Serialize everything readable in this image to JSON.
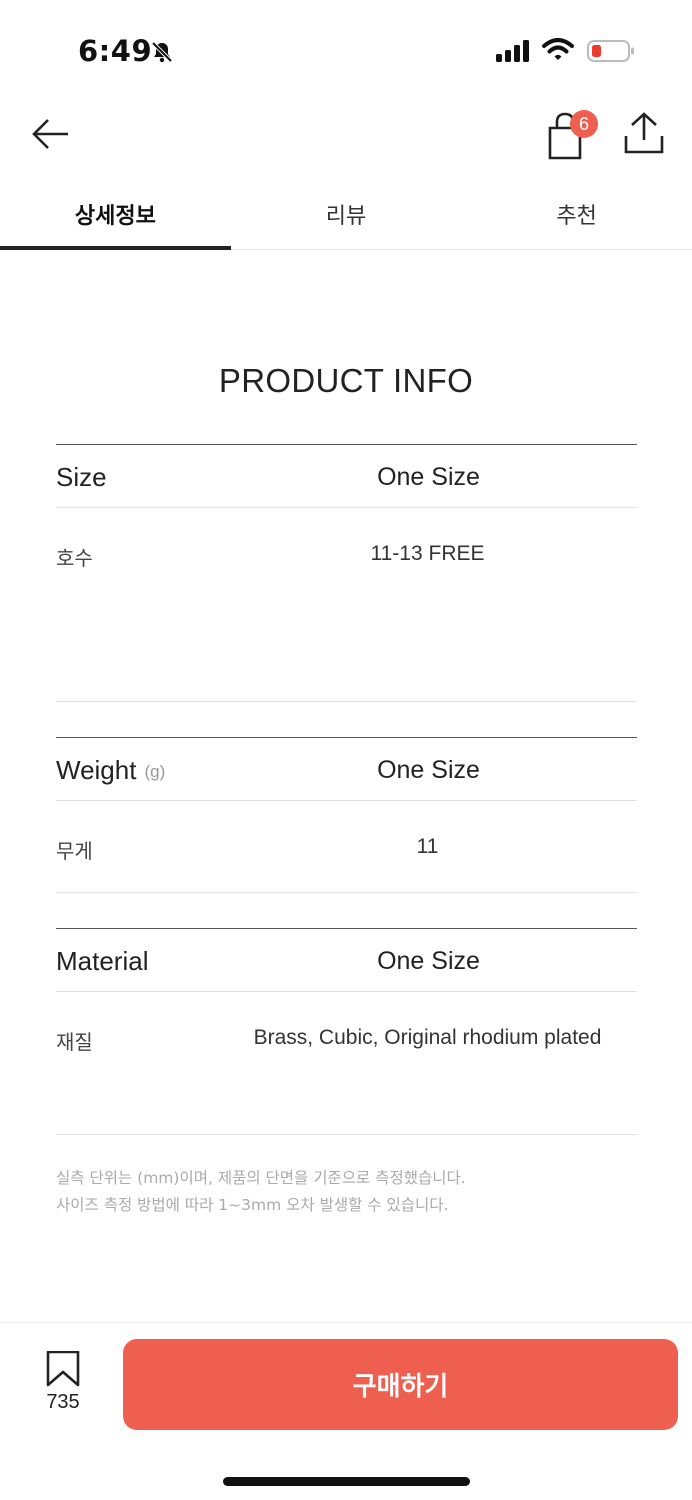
{
  "status_bar": {
    "time": "6:49",
    "icons": [
      "bell-slash-icon",
      "cellular-signal-icon",
      "wifi-icon",
      "battery-low-icon"
    ],
    "battery_color": "#ee3b30"
  },
  "nav": {
    "back_icon": "arrow-left-icon",
    "cart_icon": "shopping-bag-icon",
    "cart_badge": "6",
    "share_icon": "share-upload-icon"
  },
  "tabs": [
    {
      "label": "상세정보",
      "active": true
    },
    {
      "label": "리뷰",
      "active": false
    },
    {
      "label": "추천",
      "active": false
    }
  ],
  "product_info": {
    "title": "PRODUCT INFO",
    "sections": [
      {
        "label": "Size",
        "unit": "",
        "column": "One Size",
        "row_label": "호수",
        "row_value": "11-13 FREE"
      },
      {
        "label": "Weight",
        "unit": "(g)",
        "column": "One Size",
        "row_label": "무게",
        "row_value": "11"
      },
      {
        "label": "Material",
        "unit": "",
        "column": "One Size",
        "row_label": "재질",
        "row_value": "Brass, Cubic, Original rhodium plated"
      }
    ],
    "notes": [
      "실측 단위는 (mm)이며, 제품의 단면을 기준으로 측정했습니다.",
      "사이즈 측정 방법에 따라 1~3mm 오차 발생할 수 있습니다."
    ]
  },
  "bottom_bar": {
    "bookmark_icon": "bookmark-icon",
    "bookmark_count": "735",
    "buy_label": "구매하기",
    "accent_color": "#ee5f50"
  }
}
